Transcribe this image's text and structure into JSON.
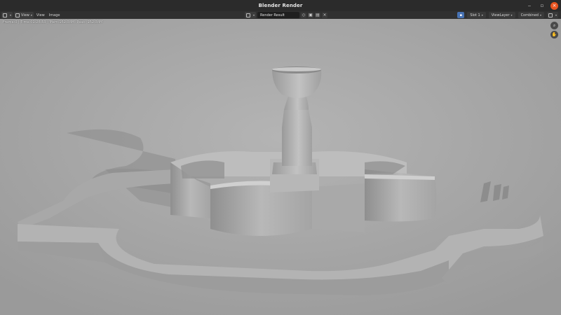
{
  "window": {
    "title": "Blender Render",
    "minimize": "‒",
    "maximize": "▫",
    "close": "×"
  },
  "header": {
    "editor_icon": "image-editor-icon",
    "menus": [
      "View",
      "View",
      "Image"
    ],
    "image_name": "Render Result",
    "slot": "Slot 1",
    "view_layer": "ViewLayer",
    "pass": "Combined"
  },
  "viewport": {
    "stats": "Frame:0 | Time:01:26.53 | Mem:152.38M, Peak: 152.38M"
  },
  "colors": {
    "accent_close": "#e95420",
    "header_bg": "#303030",
    "title_bg": "#2b2b2b"
  }
}
